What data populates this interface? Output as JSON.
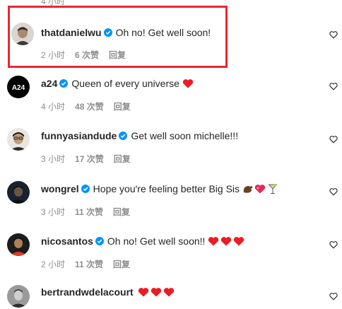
{
  "top_cutoff": "4 小时",
  "comments": [
    {
      "username": "thatdanielwu",
      "verified": true,
      "text": "Oh no! Get well soon!",
      "time": "2 小时",
      "likes": "6 次赞",
      "reply": "回复",
      "avatar": "man-avatar",
      "highlighted": true
    },
    {
      "username": "a24",
      "verified": true,
      "text": "Queen of every universe",
      "emoji": [
        "red-heart"
      ],
      "time": "4 小时",
      "likes": "48 次赞",
      "reply": "回复",
      "avatar": "a24-logo",
      "logo_text": "A24"
    },
    {
      "username": "funnyasiandude",
      "verified": true,
      "text": "Get well soon michelle!!!",
      "time": "3 小时",
      "likes": "17 次赞",
      "reply": "回复",
      "avatar": "glasses-avatar"
    },
    {
      "username": "wongrel",
      "verified": true,
      "text": "Hope you're feeling better Big Sis",
      "emoji": [
        "muscle",
        "heart-sparkle",
        "cocktail"
      ],
      "time": "3 小时",
      "likes": "11 次赞",
      "reply": "回复",
      "avatar": "dark-avatar"
    },
    {
      "username": "nicosantos",
      "verified": true,
      "text": "Oh no! Get well soon!!",
      "emoji": [
        "red-heart",
        "red-heart",
        "red-heart"
      ],
      "time": "2 小时",
      "likes": "11 次赞",
      "reply": "回复",
      "avatar": "red-shirt-avatar"
    },
    {
      "username": "bertrandwdelacourt",
      "verified": false,
      "text": "",
      "emoji": [
        "red-heart",
        "red-heart",
        "red-heart"
      ],
      "time": "",
      "likes": "",
      "reply": "",
      "avatar": "bw-avatar"
    }
  ],
  "colors": {
    "highlight": "#e8282f",
    "verified": "#0095f6",
    "heart": "#ed1c24",
    "meta": "#8e8e8e"
  }
}
